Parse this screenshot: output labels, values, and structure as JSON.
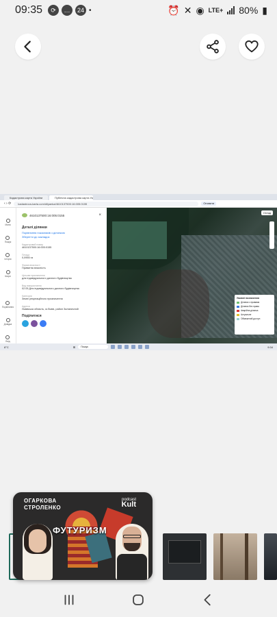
{
  "status_bar": {
    "time": "09:35",
    "notification_count": "24",
    "network": "LTE+",
    "battery": "80%"
  },
  "viewer": {
    "back_label": "Back",
    "share_label": "Share",
    "favorite_label": "Favorite"
  },
  "screenshot": {
    "browser": {
      "tabs": [
        "Кадастрова карта України",
        "Публічна кадастрова карта України"
      ],
      "address": "kadastrova-karta.com/dilyanka/4610137500:16:005:0155",
      "update_button": "Оновити"
    },
    "rail_items": [
      "Мапа",
      "Пошук",
      "Історія",
      "Шари",
      "Порівняння",
      "Довідка",
      "Вхід"
    ],
    "panel": {
      "cadastral_number": "4610137500:16:005:0155",
      "title": "Деталі ділянки",
      "link_1": "Порівняння показників з ділянкою",
      "link_2": "Зберегти до закладок",
      "fields": [
        {
          "label": "Кадастровий номер",
          "value": "4610137500:16:005:0155"
        },
        {
          "label": "Площа",
          "value": "0,0955 га"
        },
        {
          "label": "Форма власності",
          "value": "Приватна власність"
        },
        {
          "label": "Цільове призначення",
          "value": "для індивідуального дачного будівництва"
        },
        {
          "label": "Вид використання",
          "value": "02.05 Для індивідуального дачного будівництва"
        },
        {
          "label": "Категорія",
          "value": "Землі рекреаційного призначення"
        },
        {
          "label": "Адреса",
          "value": "Львівська область, м.Львів, район Залізничний"
        }
      ],
      "share_title": "Поділитися"
    },
    "map": {
      "view_button": "Огляд",
      "legend_title": "Умовні позначення",
      "legend": [
        {
          "label": "Ділянки з правами",
          "color": "#6fbf73"
        },
        {
          "label": "Ділянки без права",
          "color": "#3d7be0"
        },
        {
          "label": "Аварійна ділянка",
          "color": "#d93b3b"
        },
        {
          "label": "Актуальне",
          "color": "#e3c02d"
        },
        {
          "label": "Обмежений доступ",
          "color": "#9ad2d2"
        }
      ]
    },
    "taskbar": {
      "weather": "8°C",
      "search": "Пошук",
      "clock": "9:34"
    }
  },
  "promo": {
    "names": [
      "ОГАРКОВА",
      "СТРОЛЕНКО"
    ],
    "brand_small": "podcast",
    "brand": "Kult",
    "title": "ФУТУРИЗМ"
  },
  "nav_bar": {
    "recent": "recent-apps",
    "home": "home",
    "back": "back"
  }
}
